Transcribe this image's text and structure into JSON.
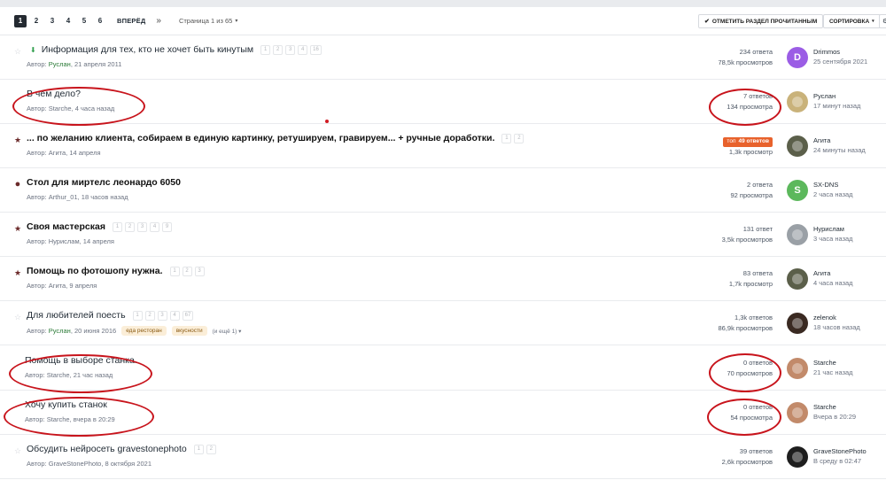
{
  "pagination": {
    "pages": [
      "1",
      "2",
      "3",
      "4",
      "5",
      "6"
    ],
    "active": "1",
    "next_label": "ВПЕРЁД",
    "last_label": "»",
    "page_info": "Страница 1 из 65",
    "caret": "▾"
  },
  "toolbar": {
    "mark_read_label": "ОТМЕТИТЬ РАЗДЕЛ ПРОЧИТАННЫМ",
    "sort_label": "СОРТИРОВКА",
    "caret": "▾"
  },
  "topics": [
    {
      "marker": "☆",
      "title": "Информация для тех, кто не хочет быть кинутым",
      "bold": false,
      "download": true,
      "mini_pages": [
        "1",
        "2",
        "3",
        "4",
        "16"
      ],
      "author_prefix": "Автор:",
      "author": "Руслан",
      "author_green": true,
      "date": ", 21 апреля 2011",
      "tags": [],
      "more": "",
      "replies": "234 ответа",
      "views": "78,5k просмотров",
      "last_user": "Drimmos",
      "last_time": "25 сентября 2021",
      "avatar_letter": "D",
      "avatar_color": "#9b5de5"
    },
    {
      "marker": "",
      "title": "В чём дело?",
      "bold": false,
      "download": false,
      "mini_pages": [],
      "author_prefix": "Автор:",
      "author": "Starche",
      "author_green": false,
      "date": ", 4 часа назад",
      "tags": [],
      "more": "",
      "replies": "7 ответов",
      "views": "134 просмотра",
      "last_user": "Руслан",
      "last_time": "17 минут назад",
      "avatar_letter": "",
      "avatar_color": "#c9b27a"
    },
    {
      "marker": "★",
      "title": "... по желанию клиента, собираем в единую картинку, ретушируем, гравируем... + ручные доработки.",
      "bold": true,
      "download": false,
      "mini_pages": [
        "1",
        "2"
      ],
      "author_prefix": "Автор:",
      "author": "Агита",
      "author_green": false,
      "date": ", 14 апреля",
      "tags": [],
      "more": "",
      "hot_top": "топ",
      "hot_label": "49 ответов",
      "replies": "",
      "views": "1,3k просмотр",
      "last_user": "Агита",
      "last_time": "24 минуты назад",
      "avatar_letter": "",
      "avatar_color": "#5b5f4a"
    },
    {
      "marker": "●",
      "title": "Стол для миртелс леонардо 6050",
      "bold": true,
      "download": false,
      "mini_pages": [],
      "author_prefix": "Автор:",
      "author": "Arthur_01",
      "author_green": false,
      "date": ", 18 часов назад",
      "tags": [],
      "more": "",
      "replies": "2 ответа",
      "views": "92 просмотра",
      "last_user": "SX-DNS",
      "last_time": "2 часа назад",
      "avatar_letter": "S",
      "avatar_color": "#5cb85c"
    },
    {
      "marker": "★",
      "title": "Своя мастерская",
      "bold": true,
      "download": false,
      "mini_pages": [
        "1",
        "2",
        "3",
        "4",
        "9"
      ],
      "author_prefix": "Автор:",
      "author": "Нурислам",
      "author_green": false,
      "date": ", 14 апреля",
      "tags": [],
      "more": "",
      "replies": "131 ответ",
      "views": "3,5k просмотров",
      "last_user": "Нурислам",
      "last_time": "3 часа назад",
      "avatar_letter": "",
      "avatar_color": "#9aa0a6"
    },
    {
      "marker": "★",
      "title": "Помощь по фотошопу нужна.",
      "bold": true,
      "download": false,
      "mini_pages": [
        "1",
        "2",
        "3"
      ],
      "author_prefix": "Автор:",
      "author": "Агита",
      "author_green": false,
      "date": ", 9 апреля",
      "tags": [],
      "more": "",
      "replies": "83 ответа",
      "views": "1,7k просмотр",
      "last_user": "Агита",
      "last_time": "4 часа назад",
      "avatar_letter": "",
      "avatar_color": "#5b5f4a"
    },
    {
      "marker": "☆",
      "title": "Для любителей поесть",
      "bold": false,
      "download": false,
      "mini_pages": [
        "1",
        "2",
        "3",
        "4",
        "67"
      ],
      "author_prefix": "Автор:",
      "author": "Руслан",
      "author_green": true,
      "date": ", 20 июня 2016",
      "tags": [
        "еда ресторан",
        "вкусности"
      ],
      "more": "(и ещё 1) ▾",
      "replies": "1,3k ответов",
      "views": "86,9k просмотров",
      "last_user": "zelenok",
      "last_time": "18 часов назад",
      "avatar_letter": "",
      "avatar_color": "#3a2a22"
    },
    {
      "marker": "",
      "title": "Помощь в выборе станка.",
      "bold": false,
      "download": false,
      "mini_pages": [],
      "author_prefix": "Автор:",
      "author": "Starche",
      "author_green": false,
      "date": ", 21 час назад",
      "tags": [],
      "more": "",
      "replies": "0 ответов",
      "views": "70 просмотров",
      "last_user": "Starche",
      "last_time": "21 час назад",
      "avatar_letter": "",
      "avatar_color": "#c28a6a"
    },
    {
      "marker": "",
      "title": "Хочу купить станок",
      "bold": false,
      "download": false,
      "mini_pages": [],
      "author_prefix": "Автор:",
      "author": "Starche",
      "author_green": false,
      "date": ", вчера в 20:29",
      "tags": [],
      "more": "",
      "replies": "0 ответов",
      "views": "54 просмотра",
      "last_user": "Starche",
      "last_time": "Вчера в 20:29",
      "avatar_letter": "",
      "avatar_color": "#c28a6a"
    },
    {
      "marker": "☆",
      "title": "Обсудить нейросеть gravestonephoto",
      "bold": false,
      "download": false,
      "mini_pages": [
        "1",
        "2"
      ],
      "author_prefix": "Автор:",
      "author": "GraveStonePhoto",
      "author_green": false,
      "date": ", 8 октября 2021",
      "tags": [],
      "more": "",
      "replies": "39 ответов",
      "views": "2,6k просмотров",
      "last_user": "GraveStonePhoto",
      "last_time": "В среду в 02:47",
      "avatar_letter": "",
      "avatar_color": "#1e1e1e"
    }
  ],
  "icons": {
    "download": "arrow-down-icon",
    "check": "✔",
    "filter": "⚙"
  }
}
